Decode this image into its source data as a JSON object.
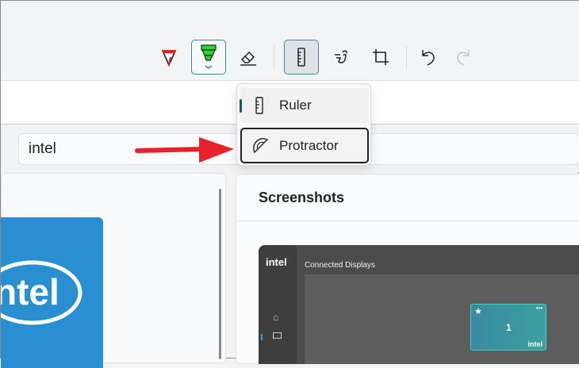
{
  "toolbar": {
    "tools": [
      {
        "name": "ballpoint-pen"
      },
      {
        "name": "highlighter",
        "selected": true
      },
      {
        "name": "eraser"
      },
      {
        "name": "ruler",
        "active": true
      },
      {
        "name": "touch-writing"
      },
      {
        "name": "crop"
      },
      {
        "name": "undo"
      },
      {
        "name": "redo",
        "disabled": true
      }
    ]
  },
  "menu": {
    "items": [
      {
        "label": "Ruler",
        "selected": true
      },
      {
        "label": "Protractor",
        "focused": true
      }
    ]
  },
  "search": {
    "value": "intel"
  },
  "right_panel": {
    "title": "Screenshots"
  },
  "screenshot": {
    "logo": "intel",
    "heading": "Connected Displays",
    "display_number": "1",
    "display_brand": "intel",
    "more": "•••"
  },
  "logo_text": "intel",
  "colors": {
    "accent": "#3f8a9a",
    "arrow": "#e8202a",
    "intel_blue": "#2a8fd0"
  }
}
